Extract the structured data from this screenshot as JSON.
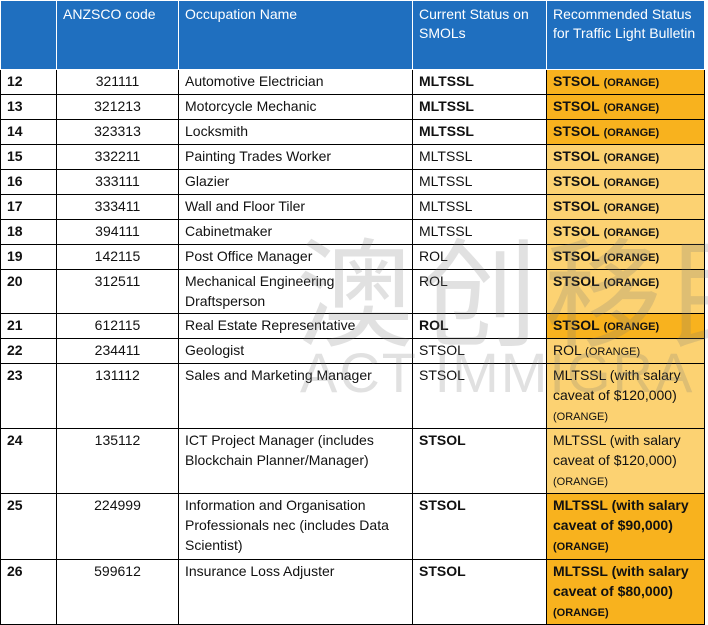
{
  "header": {
    "col_num": "",
    "col_code": "ANZSCO code",
    "col_name": "Occupation Name",
    "col_status": "Current Status on SMOLs",
    "col_rec": "Recommended Status for Traffic Light Bulletin"
  },
  "rows": [
    {
      "num": "12",
      "code": "321111",
      "name": "Automotive Electrician",
      "status": "MLTSSL",
      "rec": "STSOL",
      "tag": "(ORANGE)"
    },
    {
      "num": "13",
      "code": "321213",
      "name": "Motorcycle Mechanic",
      "status": "MLTSSL",
      "rec": "STSOL",
      "tag": "(ORANGE)"
    },
    {
      "num": "14",
      "code": "323313",
      "name": "Locksmith",
      "status": "MLTSSL",
      "rec": "STSOL",
      "tag": "(ORANGE)"
    },
    {
      "num": "15",
      "code": "332211",
      "name": "Painting Trades Worker",
      "status": "MLTSSL",
      "rec": "STSOL",
      "tag": "(ORANGE)"
    },
    {
      "num": "16",
      "code": "333111",
      "name": "Glazier",
      "status": "MLTSSL",
      "rec": "STSOL",
      "tag": "(ORANGE)"
    },
    {
      "num": "17",
      "code": "333411",
      "name": "Wall and Floor Tiler",
      "status": "MLTSSL",
      "rec": "STSOL",
      "tag": "(ORANGE)"
    },
    {
      "num": "18",
      "code": "394111",
      "name": "Cabinetmaker",
      "status": "MLTSSL",
      "rec": "STSOL",
      "tag": "(ORANGE)"
    },
    {
      "num": "19",
      "code": "142115",
      "name": "Post Office Manager",
      "status": "ROL",
      "rec": "STSOL",
      "tag": "(ORANGE)"
    },
    {
      "num": "20",
      "code": "312511",
      "name": "Mechanical Engineering Draftsperson",
      "status": "ROL",
      "rec": "STSOL",
      "tag": "(ORANGE)"
    },
    {
      "num": "21",
      "code": "612115",
      "name": "Real Estate Representative",
      "status": "ROL",
      "rec": "STSOL",
      "tag": "(ORANGE)"
    },
    {
      "num": "22",
      "code": "234411",
      "name": "Geologist",
      "status": "STSOL",
      "rec": "ROL",
      "tag": "(ORANGE)"
    },
    {
      "num": "23",
      "code": "131112",
      "name": "Sales and Marketing Manager",
      "status": "STSOL",
      "rec": "MLTSSL (with salary caveat of $120,000)",
      "tag": "(ORANGE)"
    },
    {
      "num": "24",
      "code": "135112",
      "name": "ICT Project Manager (includes Blockchain Planner/Manager)",
      "status": "STSOL",
      "rec": "MLTSSL (with salary caveat of $120,000)",
      "tag": "(ORANGE)"
    },
    {
      "num": "25",
      "code": "224999",
      "name": "Information and Organisation Professionals nec (includes Data Scientist)",
      "status": "STSOL",
      "rec": "MLTSSL (with salary caveat of $90,000)",
      "tag": "(ORANGE)"
    },
    {
      "num": "26",
      "code": "599612",
      "name": "Insurance Loss Adjuster",
      "status": "STSOL",
      "rec": "MLTSSL (with salary caveat of $80,000)",
      "tag": "(ORANGE)"
    }
  ],
  "watermark": {
    "cjk": "澳创移民",
    "latin": "ACT IMMIGRA"
  }
}
